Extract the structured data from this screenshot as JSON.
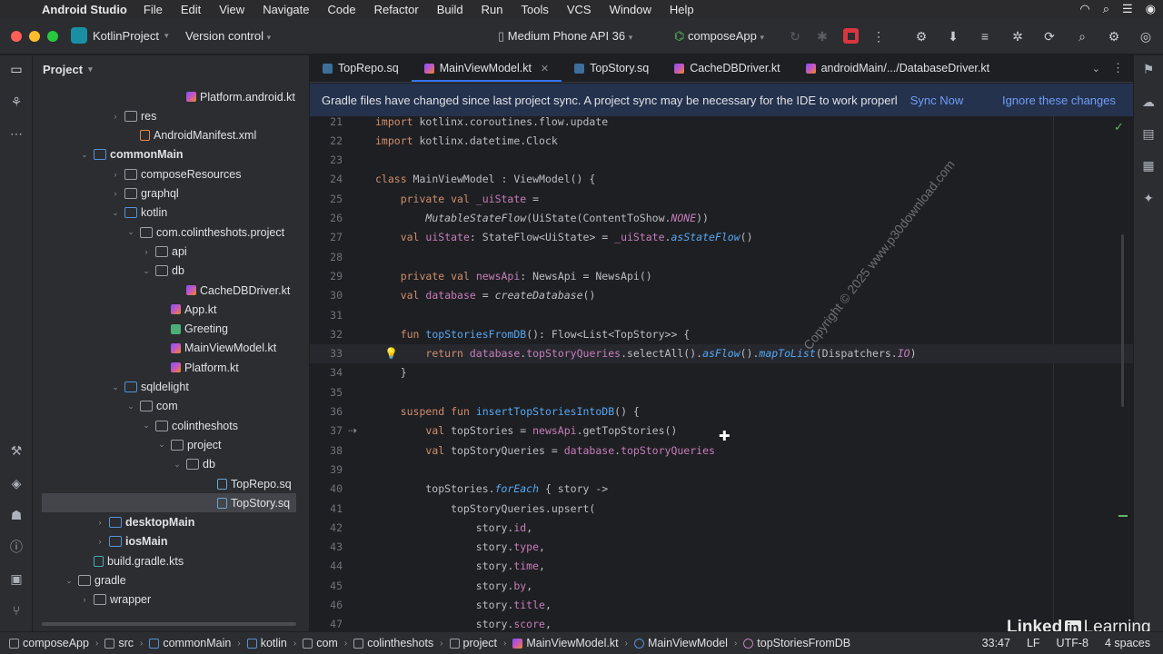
{
  "menubar": {
    "app_name": "Android Studio",
    "items": [
      "File",
      "Edit",
      "View",
      "Navigate",
      "Code",
      "Refactor",
      "Build",
      "Run",
      "Tools",
      "VCS",
      "Window",
      "Help"
    ]
  },
  "toolbar": {
    "project_name": "KotlinProject",
    "vcs_label": "Version control",
    "device": "Medium Phone API 36",
    "run_config": "composeApp"
  },
  "project_panel": {
    "title": "Project",
    "rows": [
      {
        "label": "Platform.android.kt",
        "indent": 9,
        "icon": "kt",
        "chev": ""
      },
      {
        "label": "res",
        "indent": 5,
        "icon": "folder",
        "chev": "›"
      },
      {
        "label": "AndroidManifest.xml",
        "indent": 6,
        "icon": "xml",
        "chev": ""
      },
      {
        "label": "commonMain",
        "indent": 3,
        "icon": "src",
        "chev": "⌄",
        "bold": true
      },
      {
        "label": "composeResources",
        "indent": 5,
        "icon": "folder",
        "chev": "›"
      },
      {
        "label": "graphql",
        "indent": 5,
        "icon": "folder",
        "chev": "›"
      },
      {
        "label": "kotlin",
        "indent": 5,
        "icon": "src",
        "chev": "⌄"
      },
      {
        "label": "com.colintheshots.project",
        "indent": 6,
        "icon": "folder",
        "chev": "⌄"
      },
      {
        "label": "api",
        "indent": 7,
        "icon": "folder",
        "chev": "›"
      },
      {
        "label": "db",
        "indent": 7,
        "icon": "folder",
        "chev": "⌄"
      },
      {
        "label": "CacheDBDriver.kt",
        "indent": 9,
        "icon": "kt",
        "chev": ""
      },
      {
        "label": "App.kt",
        "indent": 8,
        "icon": "kt",
        "chev": ""
      },
      {
        "label": "Greeting",
        "indent": 8,
        "icon": "compose",
        "chev": ""
      },
      {
        "label": "MainViewModel.kt",
        "indent": 8,
        "icon": "kt",
        "chev": ""
      },
      {
        "label": "Platform.kt",
        "indent": 8,
        "icon": "kt",
        "chev": ""
      },
      {
        "label": "sqldelight",
        "indent": 5,
        "icon": "src",
        "chev": "⌄"
      },
      {
        "label": "com",
        "indent": 6,
        "icon": "folder",
        "chev": "⌄"
      },
      {
        "label": "colintheshots",
        "indent": 7,
        "icon": "folder",
        "chev": "⌄"
      },
      {
        "label": "project",
        "indent": 8,
        "icon": "folder",
        "chev": "⌄"
      },
      {
        "label": "db",
        "indent": 9,
        "icon": "folder",
        "chev": "⌄"
      },
      {
        "label": "TopRepo.sq",
        "indent": 11,
        "icon": "sq",
        "chev": ""
      },
      {
        "label": "TopStory.sq",
        "indent": 11,
        "icon": "sq",
        "chev": "",
        "selected": true
      },
      {
        "label": "desktopMain",
        "indent": 4,
        "icon": "src",
        "chev": "›",
        "bold": true
      },
      {
        "label": "iosMain",
        "indent": 4,
        "icon": "src",
        "chev": "›",
        "bold": true
      },
      {
        "label": "build.gradle.kts",
        "indent": 3,
        "icon": "gradle",
        "chev": ""
      },
      {
        "label": "gradle",
        "indent": 2,
        "icon": "folder",
        "chev": "⌄"
      },
      {
        "label": "wrapper",
        "indent": 3,
        "icon": "folder",
        "chev": "›"
      }
    ]
  },
  "tabs": [
    {
      "label": "TopRepo.sq",
      "icon": "sq"
    },
    {
      "label": "MainViewModel.kt",
      "icon": "kt",
      "active": true
    },
    {
      "label": "TopStory.sq",
      "icon": "sq"
    },
    {
      "label": "CacheDBDriver.kt",
      "icon": "kt"
    },
    {
      "label": "androidMain/.../DatabaseDriver.kt",
      "icon": "kt"
    }
  ],
  "banner": {
    "message": "Gradle files have changed since last project sync. A project sync may be necessary for the IDE to work properl",
    "sync_now": "Sync Now",
    "ignore": "Ignore these changes"
  },
  "code_lines": [
    {
      "n": "21",
      "html": "<span class='kw'>import</span> kotlinx.coroutines.flow.update"
    },
    {
      "n": "22",
      "html": "<span class='kw'>import</span> kotlinx.datetime.Clock"
    },
    {
      "n": "23",
      "html": ""
    },
    {
      "n": "24",
      "html": "<span class='kw'>class</span> MainViewModel : ViewModel() {"
    },
    {
      "n": "25",
      "html": "    <span class='kw'>private val</span> <span class='prop'>_uiState</span> ="
    },
    {
      "n": "26",
      "html": "        <span class='it'>MutableStateFlow</span>(UiState(ContentToShow.<span class='const'>NONE</span>))"
    },
    {
      "n": "27",
      "html": "    <span class='kw'>val</span> <span class='prop'>uiState</span>: StateFlow&lt;UiState&gt; = <span class='prop'>_uiState</span>.<span class='ext'>asStateFlow</span>()"
    },
    {
      "n": "28",
      "html": ""
    },
    {
      "n": "29",
      "html": "    <span class='kw'>private val</span> <span class='prop'>newsApi</span>: NewsApi = NewsApi()"
    },
    {
      "n": "30",
      "html": "    <span class='kw'>val</span> <span class='prop'>database</span> = <span class='it'>createDatabase</span>()"
    },
    {
      "n": "31",
      "html": ""
    },
    {
      "n": "32",
      "html": "    <span class='kw'>fun</span> <span class='fn'>topStoriesFromDB</span>(): Flow&lt;List&lt;TopStory&gt;&gt; {"
    },
    {
      "n": "33",
      "html": "        <span class='kw'>return</span> <span class='prop'>database</span>.<span class='prop'>topStoryQueries</span>.selectAll().<span class='ext'>asFlow</span>().<span class='ext'>mapToList</span>(Dispatchers.<span class='const'>IO</span>)",
      "current": true,
      "bulb": true
    },
    {
      "n": "34",
      "html": "    }"
    },
    {
      "n": "35",
      "html": ""
    },
    {
      "n": "36",
      "html": "    <span class='kw'>suspend fun</span> <span class='fn'>insertTopStoriesIntoDB</span>() {"
    },
    {
      "n": "37",
      "html": "        <span class='kw'>val</span> topStories = <span class='prop'>newsApi</span>.getTopStories()",
      "mark": "⇢"
    },
    {
      "n": "38",
      "html": "        <span class='kw'>val</span> topStoryQueries = <span class='prop'>database</span>.<span class='prop'>topStoryQueries</span>"
    },
    {
      "n": "39",
      "html": ""
    },
    {
      "n": "40",
      "html": "        topStories.<span class='ext'>forEach</span> { story -&gt;"
    },
    {
      "n": "41",
      "html": "            topStoryQueries.upsert("
    },
    {
      "n": "42",
      "html": "                story.<span class='prop'>id</span>,"
    },
    {
      "n": "43",
      "html": "                story.<span class='prop'>type</span>,"
    },
    {
      "n": "44",
      "html": "                story.<span class='prop'>time</span>,"
    },
    {
      "n": "45",
      "html": "                story.<span class='prop'>by</span>,"
    },
    {
      "n": "46",
      "html": "                story.<span class='prop'>title</span>,"
    },
    {
      "n": "47",
      "html": "                story.<span class='prop'>score</span>,"
    }
  ],
  "watermark": "Copyright © 2025 www.p30download.com",
  "branding": {
    "linked": "Linked",
    "in": "in",
    "learning": "Learning"
  },
  "statusbar": {
    "crumbs": [
      "composeApp",
      "src",
      "commonMain",
      "kotlin",
      "com",
      "colintheshots",
      "project",
      "MainViewModel.kt",
      "MainViewModel",
      "topStoriesFromDB"
    ],
    "position": "33:47",
    "line_sep": "LF",
    "encoding": "UTF-8",
    "indent": "4 spaces"
  },
  "colors": {
    "accent": "#3574f0",
    "link": "#6f9ef8",
    "keyword": "#cf8e6d",
    "function": "#56a8f5",
    "property": "#c77dbb",
    "stop": "#d9363e"
  }
}
